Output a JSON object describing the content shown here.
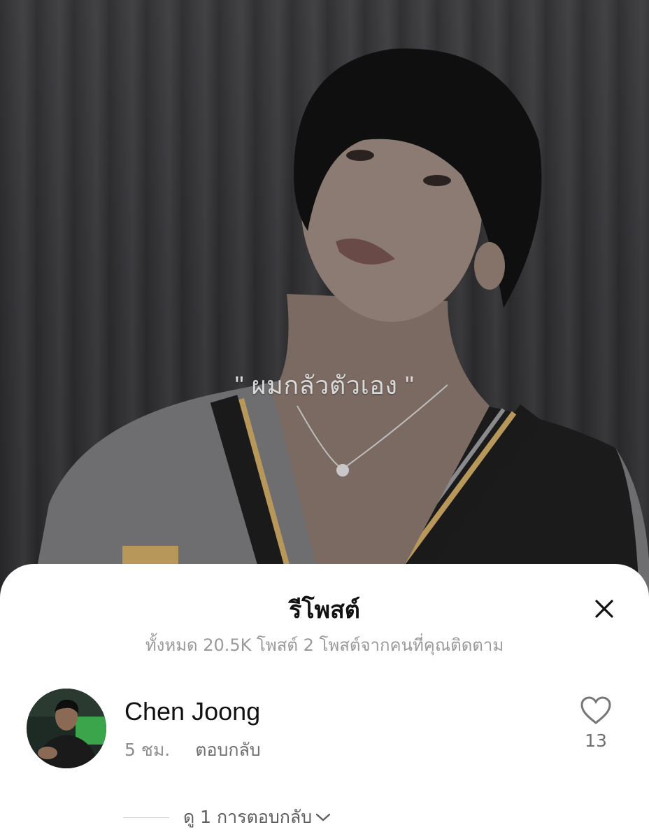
{
  "video": {
    "caption": "\" ผมกลัวตัวเอง \""
  },
  "sheet": {
    "title": "รีโพสต์",
    "subtitle": "ทั้งหมด 20.5K โพสต์ 2 โพสต์จากคนที่คุณติดตาม",
    "close_icon": "close-icon"
  },
  "repost": {
    "username": "Chen Joong",
    "time": "5 ชม.",
    "reply_label": "ตอบกลับ",
    "like_count": "13",
    "view_replies_label": "ดู 1 การตอบกลับ"
  },
  "colors": {
    "sheet_bg": "#ffffff",
    "muted_text": "#9a9a9a"
  }
}
